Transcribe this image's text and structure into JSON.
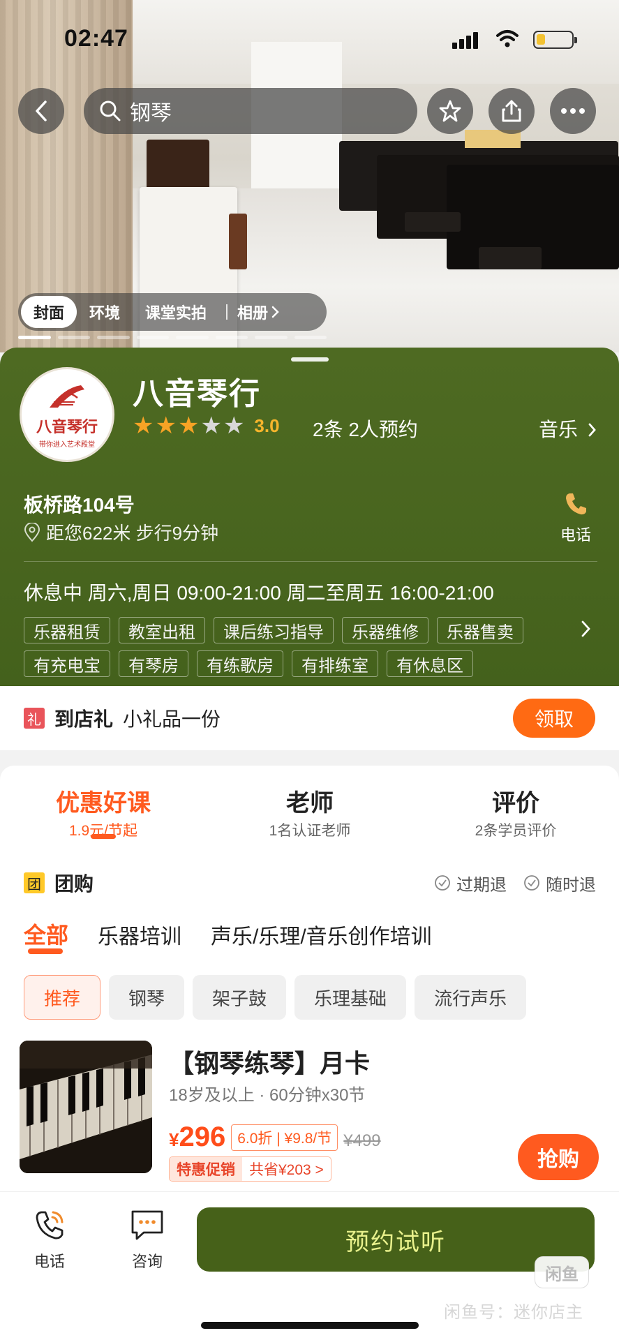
{
  "status_bar": {
    "time": "02:47",
    "battery_level": 0.25
  },
  "nav": {
    "search_text": "钢琴",
    "icons": [
      "back-icon",
      "search-icon",
      "star-icon",
      "share-icon",
      "more-icon"
    ]
  },
  "album_tabs": [
    "封面",
    "环境",
    "课堂实拍",
    "相册"
  ],
  "shop": {
    "name": "八音琴行",
    "logo_text": "八音琴行",
    "logo_slogan": "带你进入艺术殿堂",
    "rating": "3.0",
    "stars_filled": 3,
    "stars_total": 5,
    "booking": "2条  2人预约",
    "category": "音乐",
    "address": "板桥路104号",
    "distance": "距您622米 步行9分钟",
    "phone_label": "电话",
    "hours": "休息中 周六,周日 09:00-21:00 周二至周五 16:00-21:00",
    "service_tags": [
      "乐器租赁",
      "教室出租",
      "课后练习指导",
      "乐器维修",
      "乐器售卖"
    ],
    "facility_tags": [
      "有充电宝",
      "有琴房",
      "有练歌房",
      "有排练室",
      "有休息区"
    ]
  },
  "gift": {
    "badge": "礼",
    "title": "到店礼",
    "desc": "小礼品一份",
    "button": "领取"
  },
  "main_tabs": [
    {
      "title": "优惠好课",
      "sub": "1.9元/节起",
      "active": true
    },
    {
      "title": "老师",
      "sub": "1名认证老师",
      "active": false
    },
    {
      "title": "评价",
      "sub": "2条学员评价",
      "active": false
    }
  ],
  "group": {
    "badge": "团",
    "title": "团购",
    "refund1": "过期退",
    "refund2": "随时退"
  },
  "categories": [
    "全部",
    "乐器培训",
    "声乐/乐理/音乐创作培训"
  ],
  "chips": [
    "推荐",
    "钢琴",
    "架子鼓",
    "乐理基础",
    "流行声乐"
  ],
  "deal": {
    "title": "【钢琴练琴】月卡",
    "subtitle": "18岁及以上 · 60分钟x30节",
    "currency": "¥",
    "price": "296",
    "discount": "6.0折 | ¥9.8/节",
    "original_price": "¥499",
    "promo_tag": "特惠促销",
    "promo_save": "共省¥203 >",
    "buy_button": "抢购"
  },
  "bottom_bar": {
    "phone": "电话",
    "consult": "咨询",
    "cta": "预约试听",
    "watermark_logo": "闲鱼",
    "watermark_text": "闲鱼号：迷你店主"
  },
  "colors": {
    "accent": "#ff5a1f",
    "shop_green": "#4e6a22",
    "cta_green": "#466119",
    "star": "#f7a325"
  }
}
